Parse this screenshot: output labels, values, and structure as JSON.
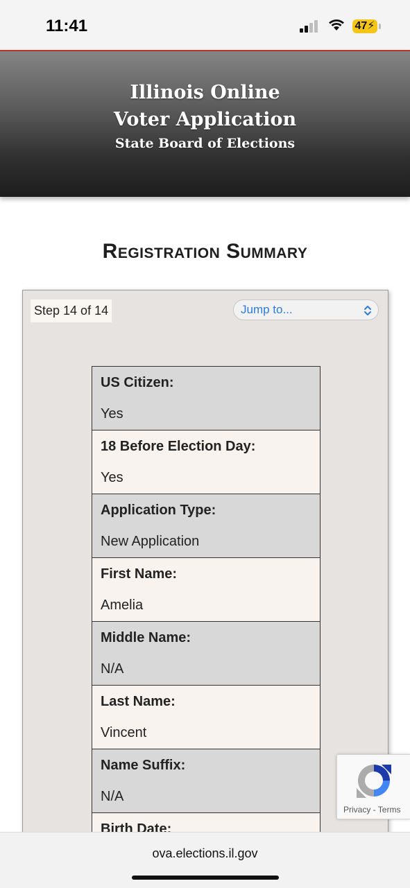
{
  "status_bar": {
    "time": "11:41",
    "battery": "47"
  },
  "header": {
    "title_line1": "Illinois Online",
    "title_line2": "Voter Application",
    "subtitle": "State Board of Elections"
  },
  "page": {
    "title": "Registration Summary"
  },
  "form": {
    "step_label": "Step 14 of 14",
    "jump_select": {
      "value": "Jump to..."
    },
    "rows": [
      {
        "label": "US Citizen:",
        "value": "Yes"
      },
      {
        "label": "18 Before Election Day:",
        "value": "Yes"
      },
      {
        "label": "Application Type:",
        "value": "New Application"
      },
      {
        "label": "First Name:",
        "value": "Amelia"
      },
      {
        "label": "Middle Name:",
        "value": "N/A"
      },
      {
        "label": "Last Name:",
        "value": "Vincent"
      },
      {
        "label": "Name Suffix:",
        "value": "N/A"
      },
      {
        "label": "Birth Date:",
        "value": ""
      }
    ]
  },
  "recaptcha": {
    "privacy": "Privacy",
    "separator": " - ",
    "terms": "Terms",
    "icon": "recaptcha-logo"
  },
  "browser": {
    "url": "ova.elections.il.gov"
  },
  "colors": {
    "accent_red": "#b5352b",
    "link_blue": "#2d7be0",
    "battery_yellow": "#f5c518"
  }
}
